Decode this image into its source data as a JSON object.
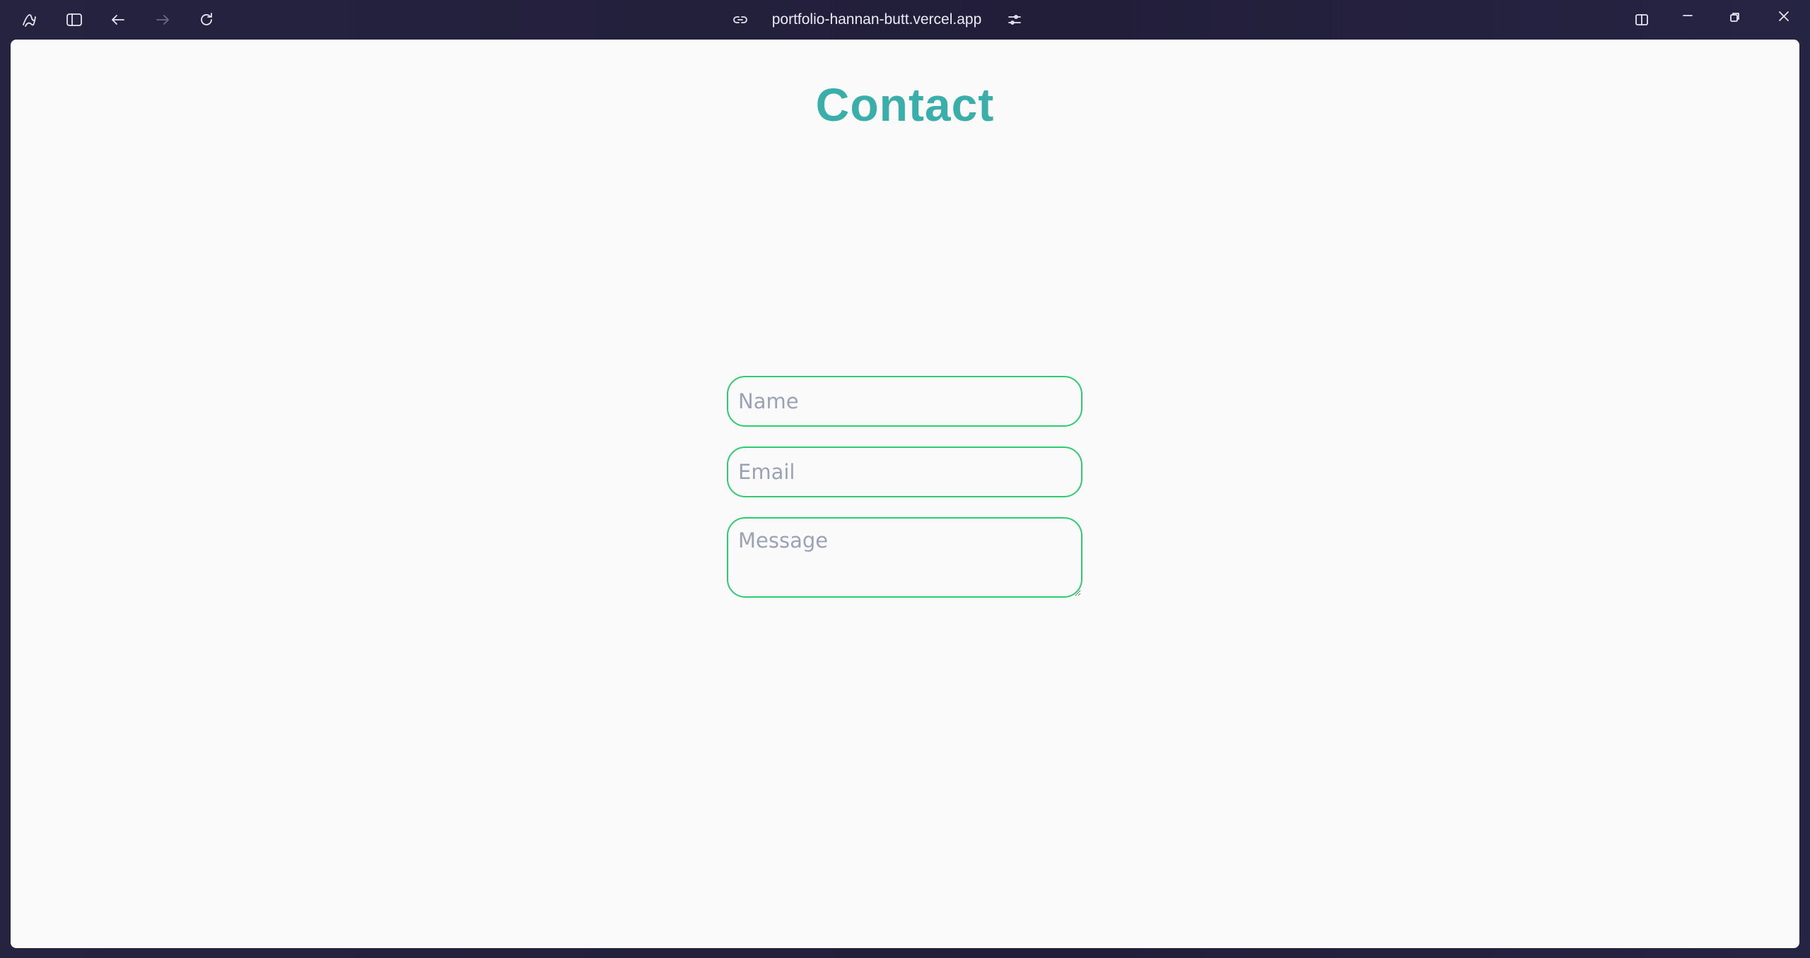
{
  "browser": {
    "url": "portfolio-hannan-butt.vercel.app",
    "icons": [
      "app-logo-icon",
      "sidebar-icon",
      "back-icon",
      "forward-icon",
      "reload-icon",
      "link-icon",
      "site-settings-icon",
      "split-view-icon",
      "minimize-icon",
      "restore-icon",
      "close-icon"
    ]
  },
  "page": {
    "title": "Contact",
    "form": {
      "name_placeholder": "Name",
      "email_placeholder": "Email",
      "message_placeholder": "Message"
    }
  },
  "colors": {
    "accent": "#3aafa9",
    "input_border": "#2ecc71",
    "chrome": "#25223f"
  }
}
